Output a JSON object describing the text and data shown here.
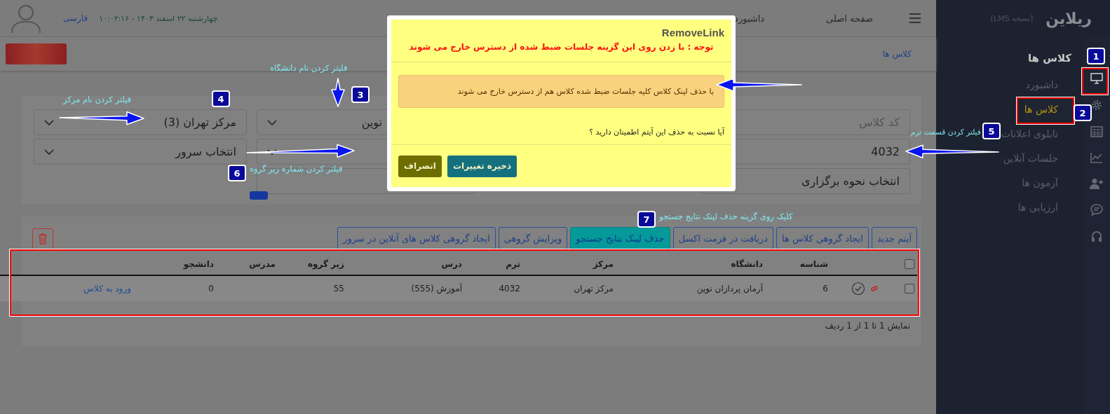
{
  "sidebar": {
    "brand": "ریلاین",
    "version_note": "[نسخه LMS]",
    "section_title": "کلاس ها",
    "items": [
      {
        "label": "داشبورد",
        "selected": false
      },
      {
        "label": "کلاس ها",
        "selected": true
      },
      {
        "label": "تابلوی اعلانات",
        "selected": false
      },
      {
        "label": "جلسات آنلاین",
        "selected": false
      },
      {
        "label": "آزمون ها",
        "selected": false
      },
      {
        "label": "ارزیابی ها",
        "selected": false
      }
    ]
  },
  "topbar": {
    "nav": [
      "صفحه اصلی",
      "داشبورد"
    ],
    "datetime": "چهارشنبه ۲۲ اسفند ۱۴۰۳ - ۱۰:۰۲:۱۶",
    "language": "فارسی"
  },
  "breadcrumb": "کلاس ها",
  "filters": [
    {
      "kind": "text",
      "placeholder": "کد کلاس"
    },
    {
      "kind": "select",
      "value": "نوین"
    },
    {
      "kind": "select",
      "value": "مرکز تهران (3)"
    },
    {
      "kind": "text",
      "value": "4032"
    },
    {
      "kind": "select"
    },
    {
      "kind": "select",
      "value": "انتخاب سرور"
    },
    {
      "kind": "plain",
      "value": "انتخاب نحوه برگزاری"
    },
    {
      "kind": "text"
    }
  ],
  "toolbar": [
    {
      "label": "آیتم جدید",
      "selected": false
    },
    {
      "label": "ایجاد گروهی کلاس ها",
      "selected": false
    },
    {
      "label": "دریافت در فرمت اکسل",
      "selected": false
    },
    {
      "label": "حذف لینک نتایج جستجو",
      "selected": true
    },
    {
      "label": "ویرایش گروهی",
      "selected": false
    },
    {
      "label": "ایجاد گروهی کلاس های آنلاین در سرور",
      "selected": false
    }
  ],
  "table": {
    "all_checked": false,
    "columns": [
      "شناسه",
      "دانشگاه",
      "مرکز",
      "ترم",
      "درس",
      "زیر گروه",
      "مدرس",
      "دانشجو"
    ],
    "rows": [
      {
        "checked": false,
        "cells": [
          "6",
          "آرمان پردازان نوین",
          "مرکز تهران",
          "4032",
          "آموزش (555)",
          "55",
          "",
          "0"
        ],
        "link": "ورود به کلاس"
      }
    ]
  },
  "pagination_info": "نمایش 1 تا 1 از 1 ردیف",
  "dialog": {
    "title": "RemoveLink",
    "warning": "توجه : با زدن روی این گزینه جلسات ضبط شده از دسترس خارج می شوند",
    "alert": "با حذف لینک کلاس کلیه جلسات ضبط شده کلاس هم از دسترس خارج می شوند",
    "question": "آیا نسبت به حذف این آیتم اطمینان دارید ؟",
    "buttons": [
      {
        "label": "ذخیره تغییرات",
        "kind": "primary"
      },
      {
        "label": "انصراف",
        "kind": "secondary"
      }
    ]
  },
  "callouts": [
    {
      "number": "1"
    },
    {
      "number": "2"
    },
    {
      "number": "3",
      "label": "فلیتر کردن نام دانشگاه"
    },
    {
      "number": "4",
      "label": "فیلتر کردن نام مرکز"
    },
    {
      "number": "5",
      "label": "فیلتر کردن قسمت ترم"
    },
    {
      "number": "6",
      "label": "فیلتر کردن شماره زیر گروه"
    },
    {
      "number": "7",
      "label": "کلیک روی گزینه حذف لینک نتایج جستجو"
    }
  ]
}
